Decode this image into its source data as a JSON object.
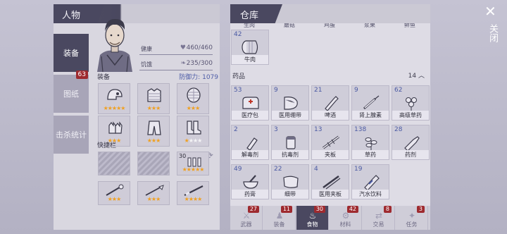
{
  "character": {
    "tab_title": "人物",
    "side_tabs": [
      {
        "label": "装备",
        "active": true
      },
      {
        "label": "图纸",
        "badge": "63"
      },
      {
        "label": "击杀统计"
      }
    ],
    "stats": [
      {
        "label": "健康",
        "value": "460/460",
        "icon": "heart-icon"
      },
      {
        "label": "饥饿",
        "value": "235/300",
        "icon": "drumstick-icon"
      }
    ],
    "equipment_label": "装备",
    "defense_label": "防御力:",
    "defense_value": "1079",
    "equipment_slots": [
      {
        "item": "helmet",
        "gold_stars": 5,
        "white_stars": 0
      },
      {
        "item": "chest-armor",
        "gold_stars": 3,
        "white_stars": 0
      },
      {
        "item": "body-armor",
        "gold_stars": 3,
        "white_stars": 0
      },
      {
        "item": "gloves",
        "gold_stars": 3,
        "white_stars": 0
      },
      {
        "item": "pants",
        "gold_stars": 3,
        "white_stars": 0
      },
      {
        "item": "boots",
        "gold_stars": 1,
        "white_stars": 3
      }
    ],
    "quickbar_label": "快捷栏",
    "quick_slots": [
      {
        "empty": true
      },
      {
        "empty": true
      },
      {
        "count": "30",
        "item": "bullets",
        "gold_stars": 5
      },
      {
        "item": "crossbow",
        "gold_stars": 3
      },
      {
        "item": "spear",
        "gold_stars": 3
      },
      {
        "item": "rifle",
        "gold_stars": 4
      }
    ]
  },
  "warehouse": {
    "tab_title": "仓库",
    "cut_off_labels": [
      "生肉",
      "蘑菇",
      "鸡蛋",
      "浆果",
      "鲜鱼"
    ],
    "food_items": [
      {
        "count": "42",
        "name": "牛肉",
        "icon": "beef-can-icon"
      }
    ],
    "medicine_section": {
      "label": "药品",
      "count": "14"
    },
    "medicine_items": [
      {
        "count": "53",
        "name": "医疗包",
        "icon": "medkit-icon"
      },
      {
        "count": "9",
        "name": "医用绷带",
        "icon": "bandage-icon"
      },
      {
        "count": "21",
        "name": "啤酒",
        "icon": "beer-icon"
      },
      {
        "count": "9",
        "name": "肾上腺素",
        "icon": "syringe-icon"
      },
      {
        "count": "62",
        "name": "高级草药",
        "icon": "herb-icon"
      },
      {
        "count": "2",
        "name": "解毒剂",
        "icon": "vial-icon"
      },
      {
        "count": "3",
        "name": "抗毒剂",
        "icon": "pills-icon"
      },
      {
        "count": "13",
        "name": "夹板",
        "icon": "splint-icon"
      },
      {
        "count": "138",
        "name": "草药",
        "icon": "herb-small-icon"
      },
      {
        "count": "28",
        "name": "药剂",
        "icon": "potion-icon"
      },
      {
        "count": "49",
        "name": "药膏",
        "icon": "mortar-icon"
      },
      {
        "count": "22",
        "name": "细带",
        "icon": "cloth-icon"
      },
      {
        "count": "4",
        "name": "医用夹板",
        "icon": "medical-splint-icon"
      },
      {
        "count": "19",
        "name": "汽水饮料",
        "icon": "soda-icon"
      }
    ],
    "bottom_tabs": [
      {
        "label": "武器",
        "badge": "27",
        "icon": "weapon-icon"
      },
      {
        "label": "装备",
        "badge": "11",
        "icon": "shirt-icon"
      },
      {
        "label": "食物",
        "badge": "30",
        "icon": "food-icon",
        "active": true
      },
      {
        "label": "材料",
        "badge": "42",
        "icon": "material-icon"
      },
      {
        "label": "交易",
        "badge": "8",
        "icon": "trade-icon"
      },
      {
        "label": "任务",
        "badge": "3",
        "icon": "quest-icon"
      }
    ]
  },
  "close": {
    "label": "关闭"
  },
  "colors": {
    "accent_dark": "#4a4860",
    "badge_red": "#9e2a2f",
    "star_gold": "#f0a020",
    "count_blue": "#4b5aa4"
  }
}
